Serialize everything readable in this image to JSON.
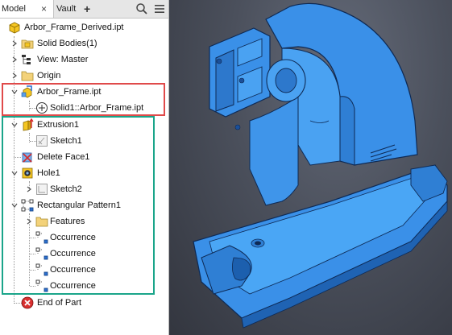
{
  "tabs": {
    "model": "Model",
    "vault": "Vault",
    "add": "+",
    "close": "×"
  },
  "toolbar": {
    "search_icon": "search-icon",
    "menu_icon": "hamburger-menu-icon"
  },
  "tree": {
    "root": "Arbor_Frame_Derived.ipt",
    "solid_bodies": "Solid Bodies(1)",
    "view": "View: Master",
    "origin": "Origin",
    "derived_part": "Arbor_Frame.ipt",
    "derived_solid": "Solid1::Arbor_Frame.ipt",
    "extrusion": "Extrusion1",
    "sketch1": "Sketch1",
    "delete_face": "Delete Face1",
    "hole": "Hole1",
    "sketch2": "Sketch2",
    "pattern": "Rectangular Pattern1",
    "features": "Features",
    "occurrences": [
      "Occurrence",
      "Occurrence",
      "Occurrence",
      "Occurrence"
    ],
    "end": "End of Part"
  },
  "colors": {
    "highlight_red": "#e04a4a",
    "highlight_green": "#1aa58a",
    "model_blue": "#3d97f0",
    "viewport_bg": "#4b505c"
  }
}
